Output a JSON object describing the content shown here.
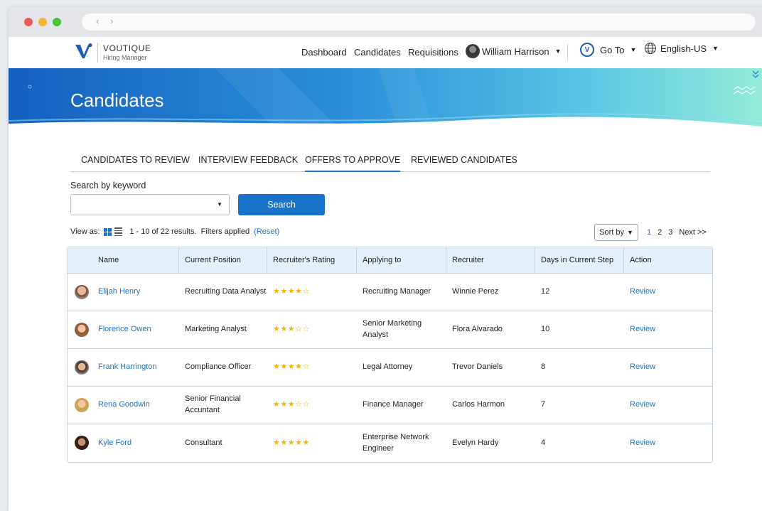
{
  "browser": {
    "nav_arrows": "‹ ›"
  },
  "brand": {
    "name": "VOUTIQUE",
    "subtitle": "Hiring Manager"
  },
  "nav": {
    "items": [
      "Dashboard",
      "Candidates",
      "Requisitions"
    ],
    "user": "William Harrison",
    "goto": "Go To",
    "language": "English-US"
  },
  "page": {
    "title": "Candidates"
  },
  "tabs": [
    {
      "label": "CANDIDATES TO REVIEW",
      "active": false
    },
    {
      "label": "INTERVIEW FEEDBACK",
      "active": false
    },
    {
      "label": "OFFERS TO APPROVE",
      "active": true
    },
    {
      "label": "REVIEWED CANDIDATES",
      "active": false
    }
  ],
  "search": {
    "label": "Search by keyword",
    "value": "",
    "button": "Search"
  },
  "results": {
    "view_as": "View as:",
    "summary": "1 - 10 of 22 results.",
    "filters": "Filters applied",
    "reset": "(Reset)",
    "sort_label": "Sort by",
    "pages": [
      "1",
      "2",
      "3"
    ],
    "current_page": "1",
    "next": "Next >>"
  },
  "table": {
    "headers": [
      "Name",
      "Current Position",
      "Recruiter's Rating",
      "Applying to",
      "Recruiter",
      "Days in Current Step",
      "Action"
    ],
    "rows": [
      {
        "name": "Elijah Henry",
        "position": "Recruiting Data Analyst",
        "rating": 4,
        "applying": "Recruiting Manager",
        "recruiter": "Winnie Perez",
        "days": "12",
        "action": "Review"
      },
      {
        "name": "Florence Owen",
        "position": "Marketing Analyst",
        "rating": 3,
        "applying": "Senior Marketing Analyst",
        "recruiter": "Flora Alvarado",
        "days": "10",
        "action": "Review"
      },
      {
        "name": "Frank Harrington",
        "position": "Compliance Officer",
        "rating": 4,
        "applying": "Legal Attorney",
        "recruiter": "Trevor Daniels",
        "days": "8",
        "action": "Review"
      },
      {
        "name": "Rena Goodwin",
        "position": "Senior Financial Accuntant",
        "rating": 3,
        "applying": "Finance Manager",
        "recruiter": "Carlos Harmon",
        "days": "7",
        "action": "Review"
      },
      {
        "name": "Kyle Ford",
        "position": "Consultant",
        "rating": 5,
        "applying": "Enterprise Network Engineer",
        "recruiter": "Evelyn Hardy",
        "days": "4",
        "action": "Review"
      }
    ],
    "max_rating": 5
  },
  "colors": {
    "accent": "#1a73c9",
    "header_bg": "#e6f0fb",
    "star": "#f4b400",
    "banner_left": "#1560c0",
    "banner_right": "#8fe8d8"
  }
}
